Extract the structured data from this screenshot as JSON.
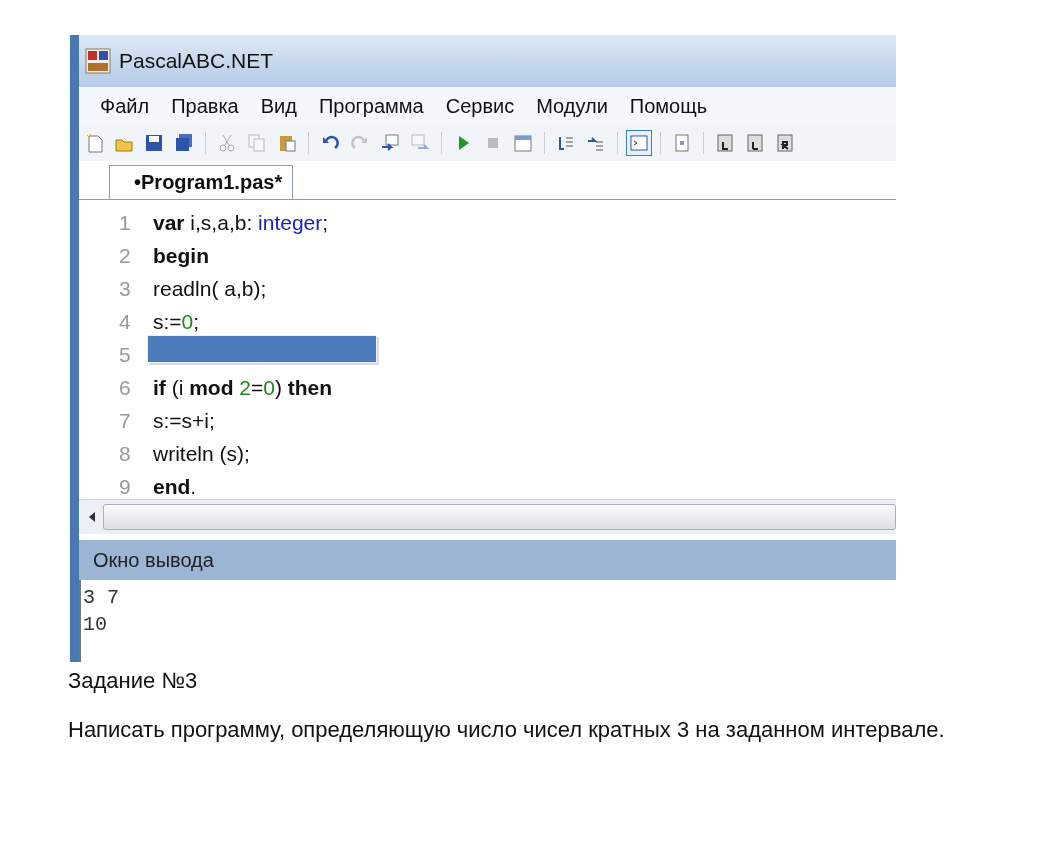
{
  "window": {
    "title": "PascalABC.NET"
  },
  "menu": [
    {
      "label": "Файл"
    },
    {
      "label": "Правка"
    },
    {
      "label": "Вид"
    },
    {
      "label": "Программа"
    },
    {
      "label": "Сервис"
    },
    {
      "label": "Модули"
    },
    {
      "label": "Помощь"
    }
  ],
  "toolbar": [
    [
      {
        "disabled": false,
        "selected": false
      },
      {
        "disabled": false,
        "selected": false
      },
      {
        "disabled": false,
        "selected": false
      },
      {
        "disabled": false,
        "selected": false
      }
    ],
    [
      {
        "disabled": true,
        "selected": false
      },
      {
        "disabled": true,
        "selected": false
      },
      {
        "disabled": false,
        "selected": false
      }
    ],
    [
      {
        "disabled": false,
        "selected": false
      },
      {
        "disabled": true,
        "selected": false
      },
      {
        "disabled": false,
        "selected": false
      },
      {
        "disabled": true,
        "selected": false
      }
    ],
    [
      {
        "disabled": false,
        "selected": false
      },
      {
        "disabled": true,
        "selected": false
      },
      {
        "disabled": false,
        "selected": false
      }
    ],
    [
      {
        "disabled": false,
        "selected": false
      },
      {
        "disabled": false,
        "selected": false
      }
    ],
    [
      {
        "disabled": false,
        "selected": true
      }
    ],
    [
      {
        "disabled": false,
        "selected": false
      }
    ],
    [
      {
        "disabled": false,
        "selected": false
      },
      {
        "disabled": false,
        "selected": false
      },
      {
        "disabled": false,
        "selected": false
      }
    ]
  ],
  "tabs": [
    {
      "label": "•Program1.pas*",
      "selected": true
    }
  ],
  "editor": {
    "lines": [
      {
        "number": "1",
        "kind": "code",
        "tokens": [
          {
            "kind": "keyword",
            "text": "var"
          },
          {
            "kind": "plain",
            "text": " i,s,a,b: "
          },
          {
            "kind": "type",
            "text": "integer"
          },
          {
            "kind": "plain",
            "text": ";"
          }
        ]
      },
      {
        "number": "2",
        "kind": "code",
        "tokens": [
          {
            "kind": "keyword",
            "text": "begin"
          }
        ]
      },
      {
        "number": "3",
        "kind": "code",
        "tokens": [
          {
            "kind": "plain",
            "text": "readln( a,b);"
          }
        ]
      },
      {
        "number": "4",
        "kind": "code",
        "tokens": [
          {
            "kind": "plain",
            "text": "s:="
          },
          {
            "kind": "number",
            "text": "0"
          },
          {
            "kind": "plain",
            "text": ";"
          }
        ]
      },
      {
        "number": "5",
        "kind": "highlight"
      },
      {
        "number": "6",
        "kind": "code",
        "tokens": [
          {
            "kind": "keyword",
            "text": "if"
          },
          {
            "kind": "plain",
            "text": " (i "
          },
          {
            "kind": "keyword",
            "text": "mod"
          },
          {
            "kind": "number",
            "text": " 2"
          },
          {
            "kind": "plain",
            "text": "="
          },
          {
            "kind": "number",
            "text": "0"
          },
          {
            "kind": "plain",
            "text": ") "
          },
          {
            "kind": "keyword",
            "text": "then"
          }
        ]
      },
      {
        "number": "7",
        "kind": "code",
        "tokens": [
          {
            "kind": "plain",
            "text": "s:=s+i;"
          }
        ]
      },
      {
        "number": "8",
        "kind": "code",
        "tokens": [
          {
            "kind": "plain",
            "text": "writeln (s);"
          }
        ]
      },
      {
        "number": "9",
        "kind": "code",
        "tokens": [
          {
            "kind": "keyword",
            "text": "end"
          },
          {
            "kind": "plain",
            "text": "."
          }
        ]
      }
    ]
  },
  "output": {
    "title": "Окно вывода",
    "lines": [
      "3 7",
      "10"
    ]
  },
  "task": {
    "heading": "Задание №3",
    "text": "Написать программу, определяющую число чисел кратных 3 на заданном интервале."
  }
}
